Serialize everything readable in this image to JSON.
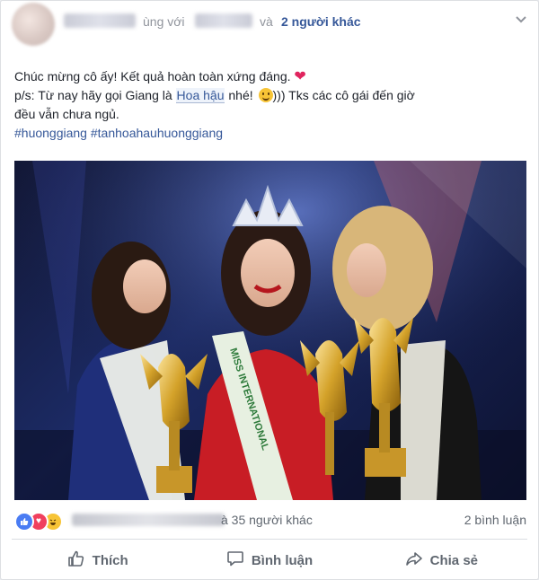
{
  "post": {
    "header": {
      "tagged_prefix": "ùng với",
      "and_separator": "và",
      "others_link": "2 người khác"
    },
    "text_line1": "Chúc mừng cô ấy! Kết quả hoàn toàn xứng đáng.",
    "text_line2_prefix": "p/s: Từ nay hãy gọi Giang là",
    "text_line2_highlight": "Hoa hậu",
    "text_line2_mid": "nhé!",
    "text_line2_suffix": "))) Tks các cô gái đến giờ",
    "text_line3": "đều vẫn chưa ngủ.",
    "hashtags": [
      "#huonggiang",
      "#tanhoahauhuonggiang"
    ],
    "photo": {
      "sash_text": "MISS INTERNATIONAL"
    },
    "reactions": {
      "icons": [
        "like-icon",
        "love-icon",
        "haha-icon"
      ],
      "count_text": "à 35 người khác",
      "comments_text": "2 bình luận"
    },
    "actions": {
      "like_label": "Thích",
      "comment_label": "Bình luận",
      "share_label": "Chia sẻ"
    }
  },
  "colors": {
    "link": "#365899",
    "meta": "#90949c",
    "heart": "#e0245e",
    "like_blue": "#4a7cf3",
    "love_red": "#f0405e",
    "haha_yellow": "#f7c436"
  }
}
